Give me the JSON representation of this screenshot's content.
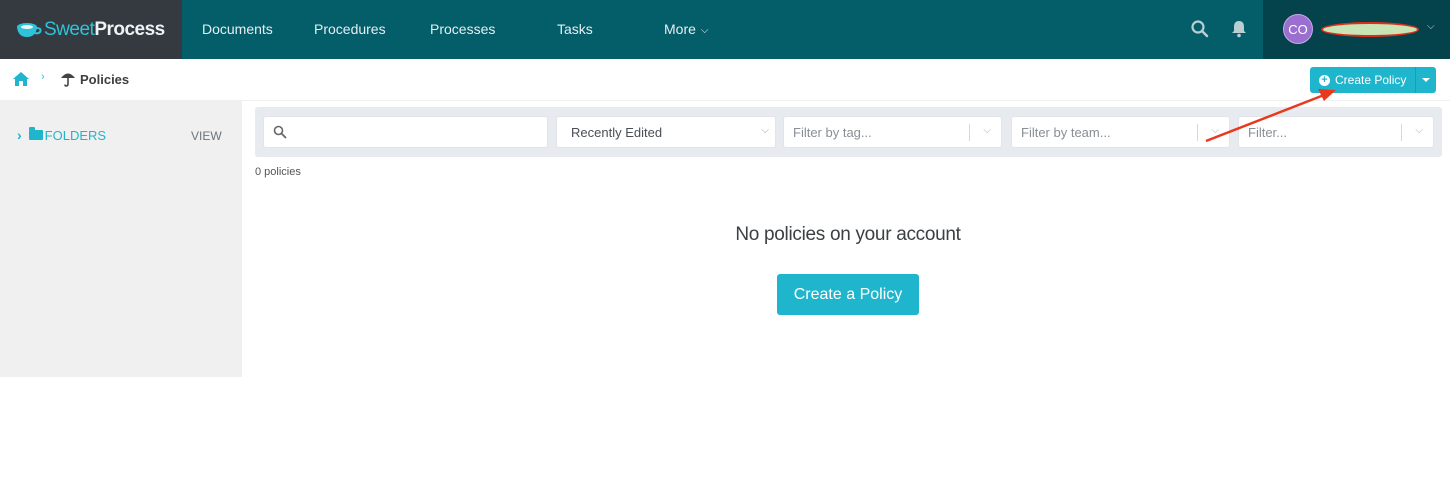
{
  "app": {
    "brand_part1": "Sweet",
    "brand_part2": "Process"
  },
  "nav": {
    "items": [
      {
        "label": "Documents"
      },
      {
        "label": "Procedures"
      },
      {
        "label": "Processes"
      },
      {
        "label": "Tasks"
      },
      {
        "label": "More"
      }
    ],
    "search_icon": "search-icon",
    "notifications_icon": "bell-icon"
  },
  "user": {
    "initials": "CO",
    "name_redacted": true
  },
  "breadcrumb": {
    "home_icon": "home-icon",
    "separator": "›",
    "section_icon": "umbrella-icon",
    "title": "Policies"
  },
  "toolbar": {
    "create_label": "Create Policy"
  },
  "sidebar": {
    "folders_label": "FOLDERS",
    "view_label": "VIEW"
  },
  "filters": {
    "search_value": "",
    "sort_selected": "Recently Edited",
    "tag_placeholder": "Filter by tag...",
    "team_placeholder": "Filter by team...",
    "misc_placeholder": "Filter..."
  },
  "list": {
    "count_text": "0 policies"
  },
  "empty_state": {
    "message": "No policies on your account",
    "button_label": "Create a Policy"
  },
  "colors": {
    "nav_bg": "#035e6a",
    "brand_bg": "#343a40",
    "accent": "#1fb6cd",
    "annotation_arrow": "#e8391f"
  }
}
